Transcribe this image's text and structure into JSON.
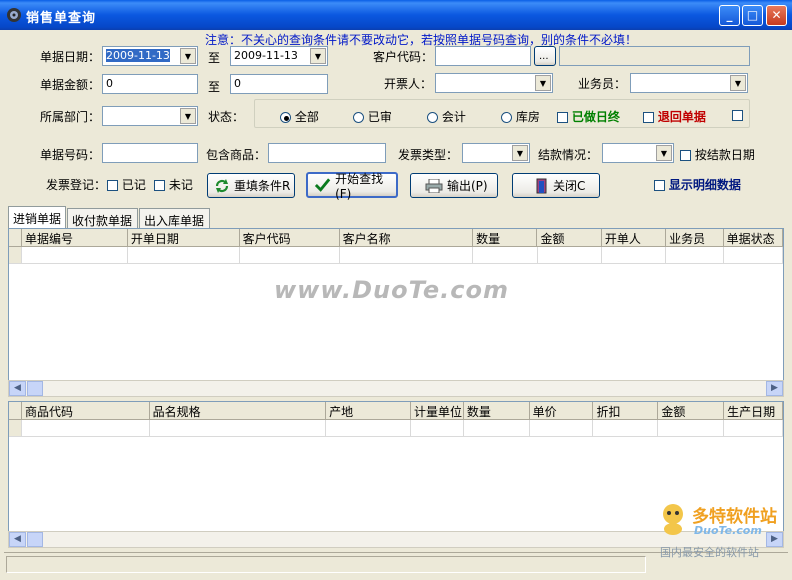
{
  "window": {
    "title": "销售单查询",
    "minimize": "_",
    "maximize": "□",
    "close": "✕"
  },
  "notice": "注意：不关心的查询条件请不要改动它，若按照单据号码查询，别的条件不必填！",
  "filters": {
    "date_label": "单据日期：",
    "date_from": "2009-11-13",
    "to_label": "至",
    "date_to": "2009-11-13",
    "customer_code_label": "客户代码：",
    "customer_code": "",
    "customer_lookup": "...",
    "customer_name": "",
    "amount_label": "单据金额：",
    "amount_from": "0",
    "amount_to": "0",
    "invoicer_label": "开票人：",
    "invoicer": "",
    "salesman_label": "业务员：",
    "salesman": "",
    "dept_label": "所属部门：",
    "dept": "",
    "status_label": "状态：",
    "status_options": [
      "全部",
      "已审",
      "会计",
      "库房"
    ],
    "status_selected": "全部",
    "day_end_label": "已做日终",
    "returned_label": "退回单据",
    "doc_no_label": "单据号码：",
    "doc_no": "",
    "contains_goods_label": "包含商品：",
    "contains_goods": "",
    "invoice_type_label": "发票类型：",
    "invoice_type": "",
    "settlement_label": "结款情况：",
    "settlement": "",
    "by_settle_date_label": "按结款日期",
    "invoice_reg_label": "发票登记：",
    "registered_label": "已记",
    "unregistered_label": "未记"
  },
  "buttons": {
    "reset": "重填条件R",
    "search": "开始查找(F)",
    "export": "输出(P)",
    "close": "关闭C"
  },
  "show_detail_label": "显示明细数据",
  "tabs": [
    "进销单据",
    "收付款单据",
    "出入库单据"
  ],
  "upper_grid": {
    "columns": [
      "单据编号",
      "开单日期",
      "客户代码",
      "客户名称",
      "数量",
      "金额",
      "开单人",
      "业务员",
      "单据状态"
    ]
  },
  "lower_grid": {
    "columns": [
      "商品代码",
      "品名规格",
      "产地",
      "计量单位",
      "数量",
      "单价",
      "折扣",
      "金额",
      "生产日期"
    ]
  },
  "watermark": "www.DuoTe.com",
  "logo": {
    "name": "多特软件站",
    "url": "DuoTe.com",
    "slogan": "国内最安全的软件站"
  },
  "colors": {
    "notice": "#0018C8",
    "day_end": "#008000",
    "returned": "#C00000",
    "show_detail": "#001880"
  }
}
